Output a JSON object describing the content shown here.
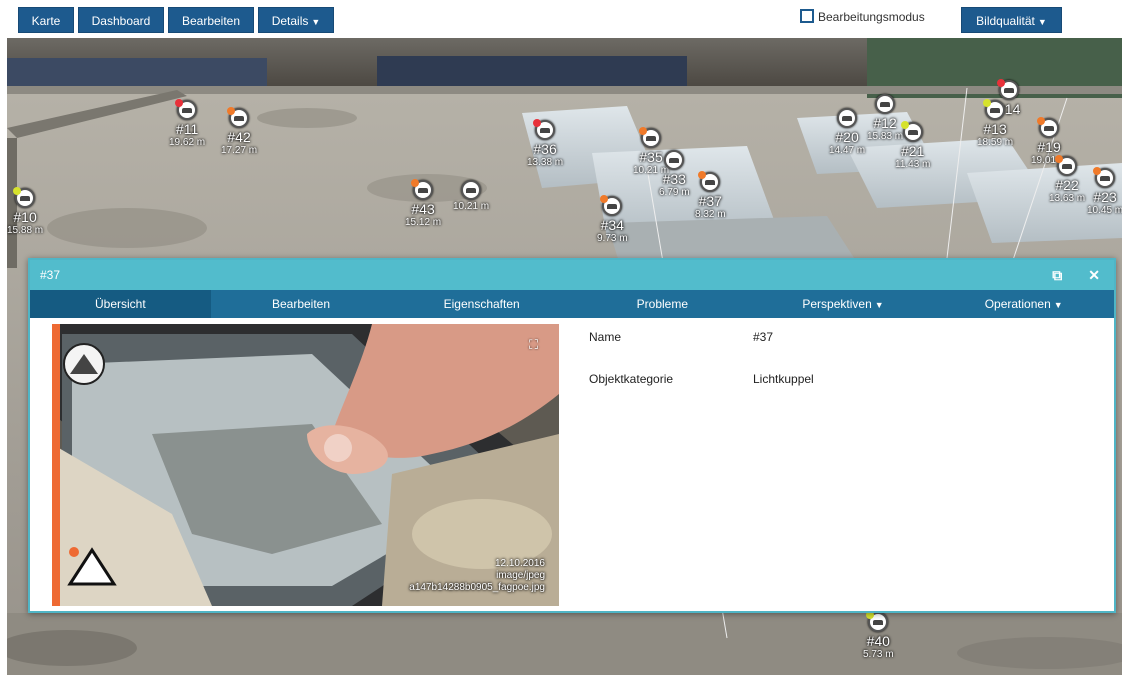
{
  "toolbar": {
    "buttons": [
      "Karte",
      "Dashboard",
      "Bearbeiten",
      "Details"
    ],
    "edit_mode_label": "Bearbeitungsmodus",
    "image_quality_label": "Bildqualität"
  },
  "markers": [
    {
      "num": "#11",
      "dist": "19.62 m",
      "dot": "#e8313a"
    },
    {
      "num": "#42",
      "dist": "17.27 m",
      "dot": "#f07a2a"
    },
    {
      "num": "#10",
      "dist": "15.88 m",
      "dot": "#d6e22d"
    },
    {
      "num": "#43",
      "dist": "15.12 m",
      "dot": "#f07a2a"
    },
    {
      "num": "",
      "dist": "10.21 m",
      "dot": ""
    },
    {
      "num": "#36",
      "dist": "13.38 m",
      "dot": "#e8313a"
    },
    {
      "num": "#35",
      "dist": "10.21 m",
      "dot": "#f07a2a"
    },
    {
      "num": "#33",
      "dist": "6.79 m",
      "dot": ""
    },
    {
      "num": "#37",
      "dist": "8.32 m",
      "dot": "#f07a2a"
    },
    {
      "num": "#34",
      "dist": "9.73 m",
      "dot": "#f07a2a"
    },
    {
      "num": "#20",
      "dist": "14.47 m",
      "dot": ""
    },
    {
      "num": "#12",
      "dist": "15.83 m",
      "dot": ""
    },
    {
      "num": "#21",
      "dist": "11.43 m",
      "dot": "#d6e22d"
    },
    {
      "num": "#14",
      "dist": "",
      "dot": "#e8313a"
    },
    {
      "num": "#13",
      "dist": "18.59 m",
      "dot": "#d6e22d"
    },
    {
      "num": "#19",
      "dist": "19.01 m",
      "dot": "#f07a2a"
    },
    {
      "num": "#22",
      "dist": "13.63 m",
      "dot": "#f07a2a"
    },
    {
      "num": "#23",
      "dist": "10.45 m",
      "dot": "#f07a2a"
    },
    {
      "num": "#40",
      "dist": "5.73 m",
      "dot": "#d6e22d"
    }
  ],
  "panel": {
    "title": "#37",
    "tabs": [
      "Übersicht",
      "Bearbeiten",
      "Eigenschaften",
      "Probleme",
      "Perspektiven",
      "Operationen"
    ],
    "photo_caption": [
      "12.10.2016",
      "image/jpeg",
      "a147b14288b0905_fagpoe.jpg"
    ],
    "properties": [
      {
        "label": "Name",
        "value": "#37"
      },
      {
        "label": "Objektkategorie",
        "value": "Lichtkuppel"
      }
    ]
  },
  "colors": {
    "toolbar_button": "#1d5a8e",
    "panel_header": "#52bccc",
    "tab_bar": "#1f6e99",
    "active_tab": "#155b82",
    "photo_accent": "#ee6a33"
  }
}
